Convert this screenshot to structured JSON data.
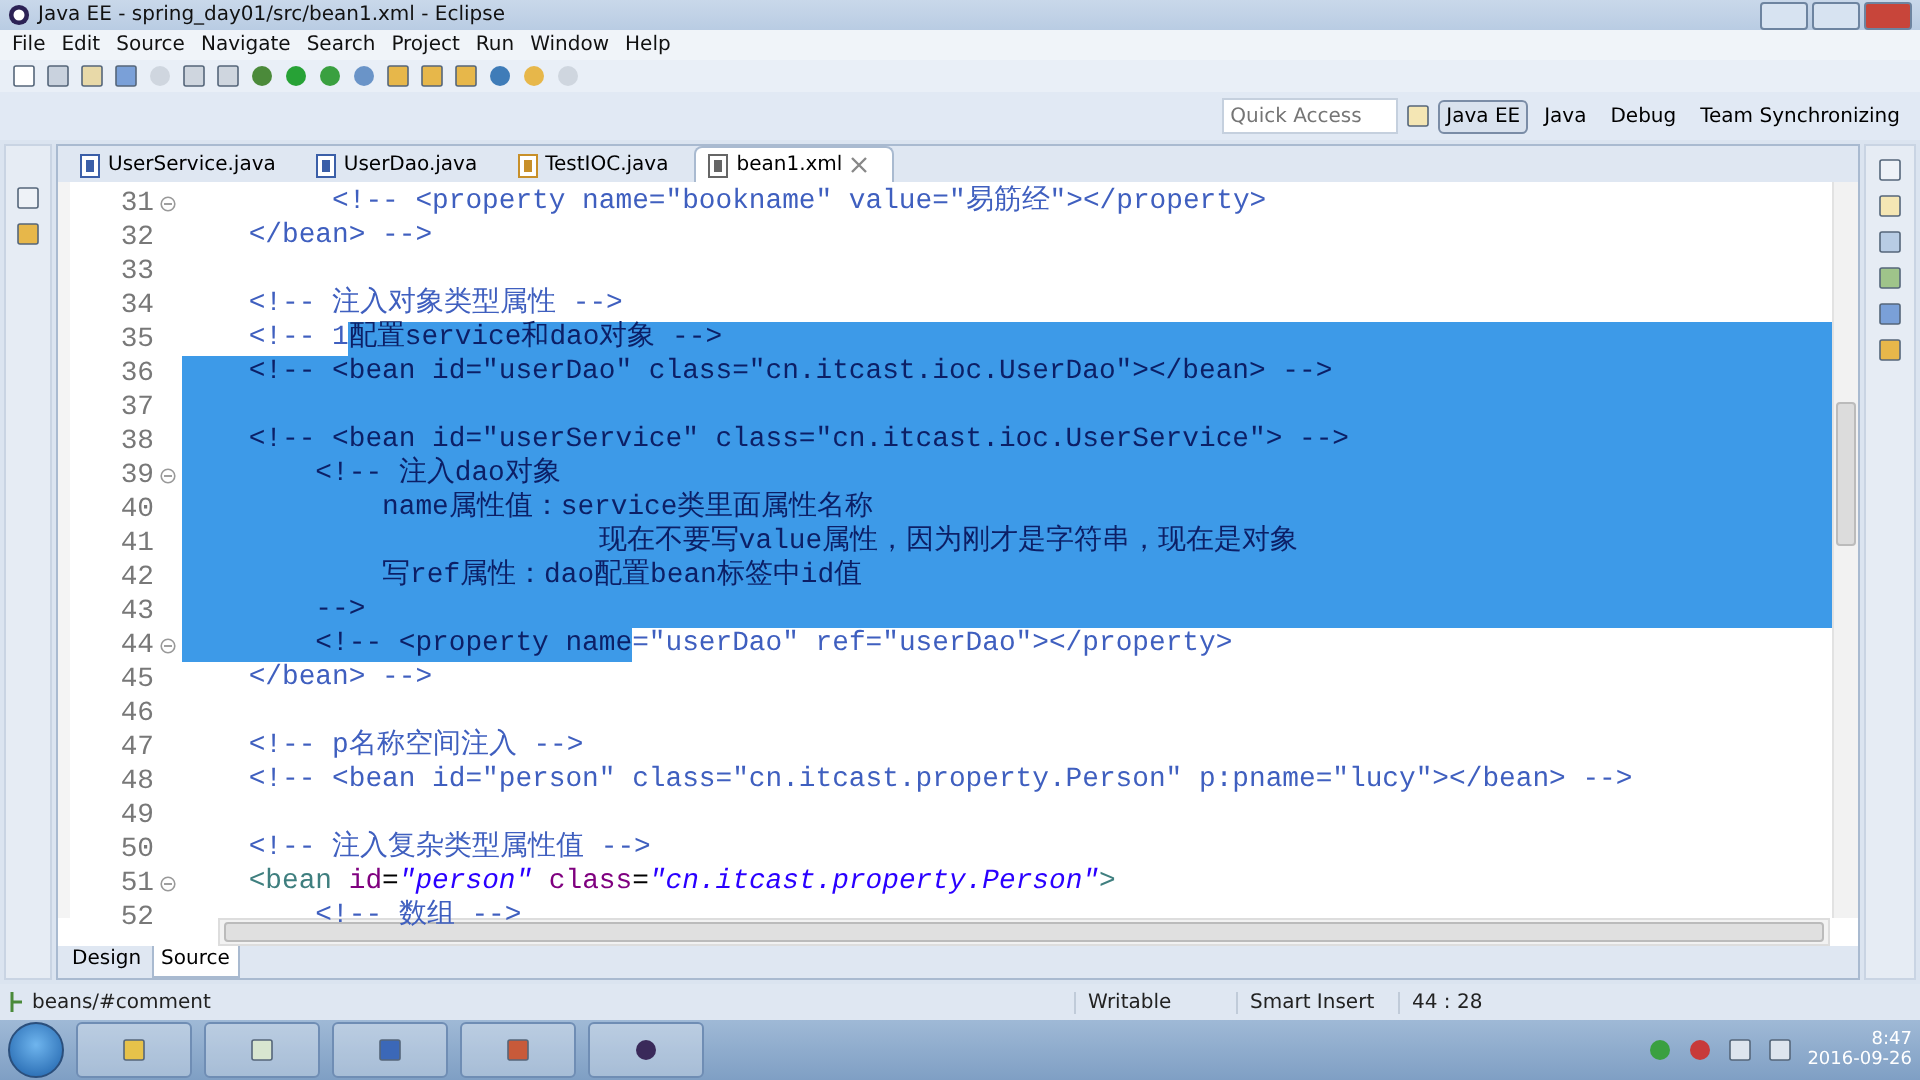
{
  "window": {
    "title": "Java EE - spring_day01/src/bean1.xml - Eclipse"
  },
  "menu": [
    "File",
    "Edit",
    "Source",
    "Navigate",
    "Search",
    "Project",
    "Run",
    "Window",
    "Help"
  ],
  "quick_access": {
    "placeholder": "Quick Access"
  },
  "perspectives": [
    {
      "label": "Java EE",
      "selected": true
    },
    {
      "label": "Java",
      "selected": false
    },
    {
      "label": "Debug",
      "selected": false
    },
    {
      "label": "Team Synchronizing",
      "selected": false
    }
  ],
  "editor_tabs": [
    {
      "label": "UserService.java",
      "kind": "java",
      "selected": false
    },
    {
      "label": "UserDao.java",
      "kind": "java",
      "selected": false
    },
    {
      "label": "TestIOC.java",
      "kind": "test",
      "selected": false
    },
    {
      "label": "bean1.xml",
      "kind": "xml",
      "selected": true
    }
  ],
  "lines": [
    {
      "number": "31",
      "fold": true,
      "selected": false,
      "segments": [
        {
          "text": "         <!-- <property name=\"bookname\" value=\"易筋经\"></property>",
          "kind": "comment",
          "selected": false
        }
      ]
    },
    {
      "number": "32",
      "fold": false,
      "selected": false,
      "segments": [
        {
          "text": "    </bean> -->",
          "kind": "comment",
          "selected": false
        }
      ]
    },
    {
      "number": "33",
      "fold": false,
      "selected": false
    },
    {
      "number": "34",
      "fold": false,
      "selected": false,
      "segments": [
        {
          "text": "    <!-- 注入对象类型属性 -->",
          "kind": "comment",
          "selected": false
        }
      ]
    },
    {
      "number": "35",
      "fold": false,
      "selected": true,
      "segments": [
        {
          "text": "    <!-- 1",
          "kind": "comment",
          "selected": false
        },
        {
          "text": "配置service和dao对象 -->",
          "kind": "comment",
          "selected": true
        }
      ]
    },
    {
      "number": "36",
      "fold": false,
      "selected": true,
      "segments": [
        {
          "text": "    <!-- <bean id=\"userDao\" class=\"cn.itcast.ioc.UserDao\"></bean> -->",
          "kind": "comment",
          "selected": true
        }
      ]
    },
    {
      "number": "37",
      "fold": false,
      "selected": true
    },
    {
      "number": "38",
      "fold": false,
      "selected": true,
      "segments": [
        {
          "text": "    <!-- <bean id=\"userService\" class=\"cn.itcast.ioc.UserService\"> -->",
          "kind": "comment",
          "selected": true
        }
      ]
    },
    {
      "number": "39",
      "fold": true,
      "selected": true,
      "segments": [
        {
          "text": "        <!-- 注入dao对象",
          "kind": "comment",
          "selected": true
        }
      ]
    },
    {
      "number": "40",
      "fold": false,
      "selected": true,
      "segments": [
        {
          "text": "            name属性值：service类里面属性名称",
          "kind": "comment",
          "selected": true
        }
      ]
    },
    {
      "number": "41",
      "fold": false,
      "selected": true,
      "segments": [
        {
          "text": "                         现在不要写value属性，因为刚才是字符串，现在是对象",
          "kind": "comment",
          "selected": true
        }
      ]
    },
    {
      "number": "42",
      "fold": false,
      "selected": true,
      "segments": [
        {
          "text": "            写ref属性：dao配置bean标签中id值",
          "kind": "comment",
          "selected": true
        }
      ]
    },
    {
      "number": "43",
      "fold": false,
      "selected": true,
      "segments": [
        {
          "text": "        -->",
          "kind": "comment",
          "selected": true
        }
      ]
    },
    {
      "number": "44",
      "fold": true,
      "selected": false,
      "segments": [
        {
          "text": "        <!-- <property name",
          "kind": "comment",
          "selected": true
        },
        {
          "text": "=\"userDao\" ref=\"userDao\"></property>",
          "kind": "comment",
          "selected": false
        }
      ]
    },
    {
      "number": "45",
      "fold": false,
      "selected": false,
      "segments": [
        {
          "text": "    </bean> -->",
          "kind": "comment",
          "selected": false
        }
      ]
    },
    {
      "number": "46",
      "fold": false,
      "selected": false
    },
    {
      "number": "47",
      "fold": false,
      "selected": false,
      "segments": [
        {
          "text": "    <!-- p名称空间注入 -->",
          "kind": "comment",
          "selected": false
        }
      ]
    },
    {
      "number": "48",
      "fold": false,
      "selected": false,
      "segments": [
        {
          "text": "    <!-- <bean id=\"person\" class=\"cn.itcast.property.Person\" p:pname=\"lucy\"></bean> -->",
          "kind": "comment",
          "selected": false
        }
      ]
    },
    {
      "number": "49",
      "fold": false,
      "selected": false
    },
    {
      "number": "50",
      "fold": false,
      "selected": false,
      "segments": [
        {
          "text": "    <!-- 注入复杂类型属性值 -->",
          "kind": "comment",
          "selected": false
        }
      ]
    },
    {
      "number": "51",
      "fold": true,
      "selected": false,
      "segments": [
        {
          "text": "    <bean",
          "kind": "tag",
          "selected": false
        },
        {
          "text": " id",
          "kind": "attr",
          "selected": false
        },
        {
          "text": "=",
          "kind": "plain",
          "selected": false
        },
        {
          "text": "\"person\"",
          "kind": "value",
          "selected": false
        },
        {
          "text": " class",
          "kind": "attr",
          "selected": false
        },
        {
          "text": "=",
          "kind": "plain",
          "selected": false
        },
        {
          "text": "\"cn.itcast.property.Person\"",
          "kind": "value",
          "selected": false
        },
        {
          "text": ">",
          "kind": "tag",
          "selected": false
        }
      ]
    },
    {
      "number": "52",
      "fold": false,
      "selected": false,
      "segments": [
        {
          "text": "        <!-- 数组 -->",
          "kind": "comment",
          "selected": false
        }
      ]
    }
  ],
  "bottom_tabs": [
    {
      "label": "Design",
      "selected": false
    },
    {
      "label": "Source",
      "selected": true
    }
  ],
  "status_bar": {
    "path": "beans/#comment",
    "mode": "Writable",
    "insert": "Smart Insert",
    "position": "44 : 28"
  },
  "taskbar": {
    "time": "8:47",
    "date": "2016-09-26"
  }
}
